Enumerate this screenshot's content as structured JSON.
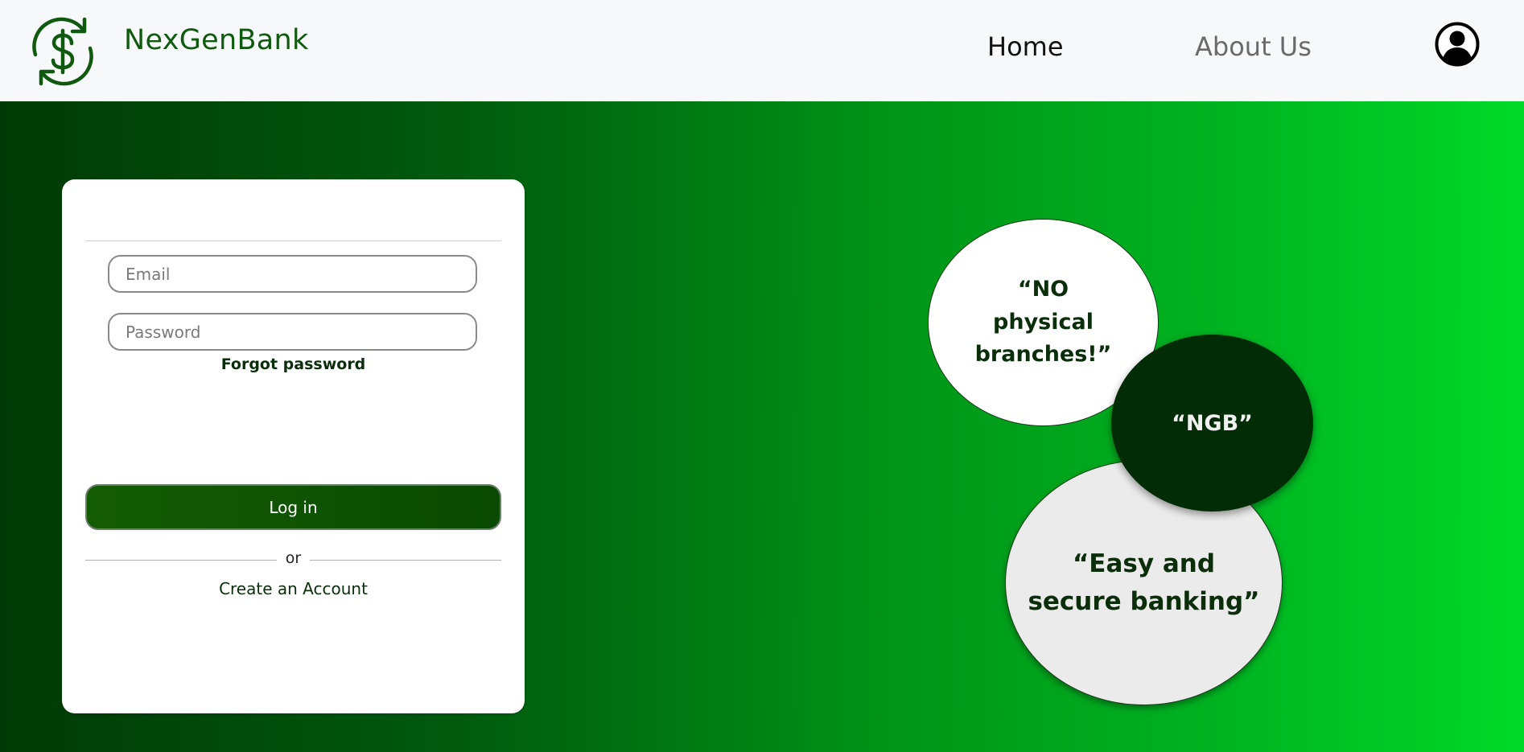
{
  "brand": {
    "name": "NexGenBank",
    "logo_icon": "dollar-exchange-icon",
    "color": "#0f5a0f"
  },
  "nav": {
    "home_label": "Home",
    "about_label": "About Us",
    "profile_icon": "user-circle-icon"
  },
  "login": {
    "email_placeholder": "Email",
    "password_placeholder": "Password",
    "forgot_label": "Forgot password",
    "login_label": "Log in",
    "or_label": "or",
    "create_label": "Create an Account"
  },
  "bubbles": {
    "first": "“NO physical branches!”",
    "second": "“NGB”",
    "third": "“Easy and secure banking”"
  },
  "colors": {
    "hero_gradient_start": "#013a06",
    "hero_gradient_end": "#00d929",
    "button": "#145c04",
    "dark_bubble": "#022c05"
  }
}
